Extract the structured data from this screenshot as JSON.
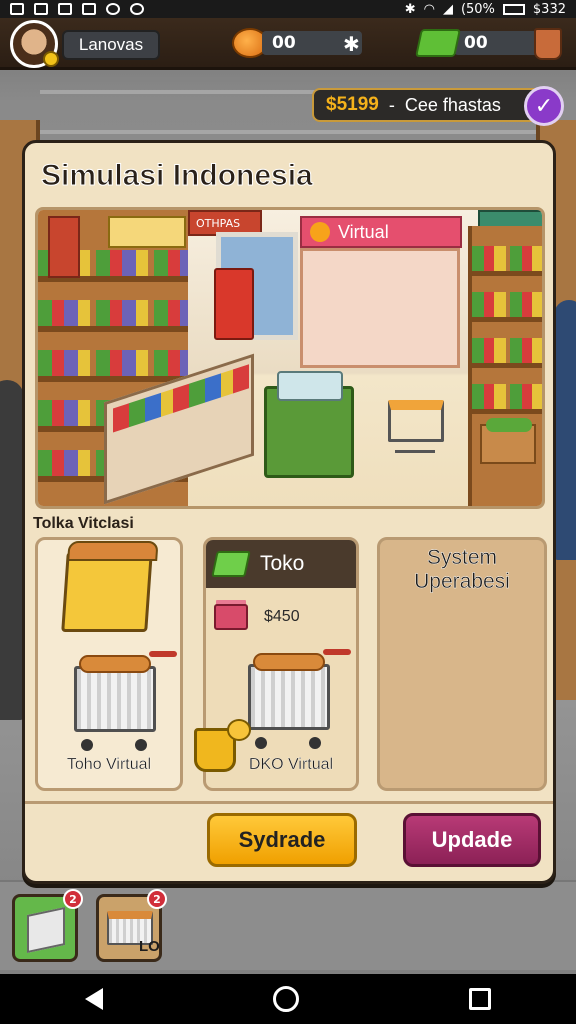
{
  "status_bar": {
    "battery": "(50%",
    "time": "$332"
  },
  "hud": {
    "player_name": "Lanovas",
    "resource_1": "00",
    "resource_2": "00"
  },
  "money": {
    "amount": "$5199",
    "separator": "-",
    "label": "Cee fhastas"
  },
  "panel": {
    "title": "Simulasi Indonesia",
    "scene": {
      "banner": "Virtual",
      "sign_top": "OTHPAS"
    },
    "section_label": "Tolka Vitclasi",
    "cards": [
      {
        "caption": "Toho Virtual"
      },
      {
        "title": "Toko",
        "price": "$450",
        "caption": "DKO Virtual"
      },
      {
        "heading_line1": "System",
        "heading_line2": "Uperabesi"
      }
    ],
    "buttons": {
      "upgrade": "Sydrade",
      "update": "Updade"
    }
  },
  "inventory": {
    "slots": [
      {
        "badge": "2"
      },
      {
        "badge": "2",
        "count": "LO"
      }
    ]
  },
  "colors": {
    "panel_bg": "#f1e2c3",
    "upgrade_btn": "#ffc93a",
    "update_btn": "#8c2156",
    "money_text": "#f5b21b",
    "check_btn": "#8a3ac9"
  }
}
